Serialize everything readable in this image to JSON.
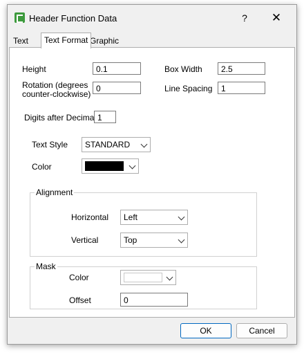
{
  "window": {
    "title": "Header Function Data",
    "help_label": "?",
    "close_label": "✕"
  },
  "tabs": [
    {
      "label": "Text"
    },
    {
      "label": "Text Format"
    },
    {
      "label": "Graphic"
    }
  ],
  "form": {
    "height": {
      "label": "Height",
      "value": "0.1"
    },
    "rotation": {
      "label_line1": "Rotation (degrees",
      "label_line2": "counter-clockwise)",
      "value": "0"
    },
    "box_width": {
      "label": "Box Width",
      "value": "2.5"
    },
    "line_spacing": {
      "label": "Line Spacing",
      "value": "1"
    },
    "digits": {
      "label": "Digits after Decimal",
      "value": "1"
    },
    "text_style": {
      "label": "Text Style",
      "value": "STANDARD"
    },
    "color": {
      "label": "Color",
      "swatch": "#000000"
    }
  },
  "alignment": {
    "title": "Alignment",
    "horizontal": {
      "label": "Horizontal",
      "value": "Left"
    },
    "vertical": {
      "label": "Vertical",
      "value": "Top"
    }
  },
  "mask": {
    "title": "Mask",
    "color": {
      "label": "Color",
      "swatch": "#ffffff"
    },
    "offset": {
      "label": "Offset",
      "value": "0"
    }
  },
  "buttons": {
    "ok": "OK",
    "cancel": "Cancel"
  },
  "colors": {
    "accent": "#0067c0",
    "icon_green": "#3d9a3d"
  }
}
